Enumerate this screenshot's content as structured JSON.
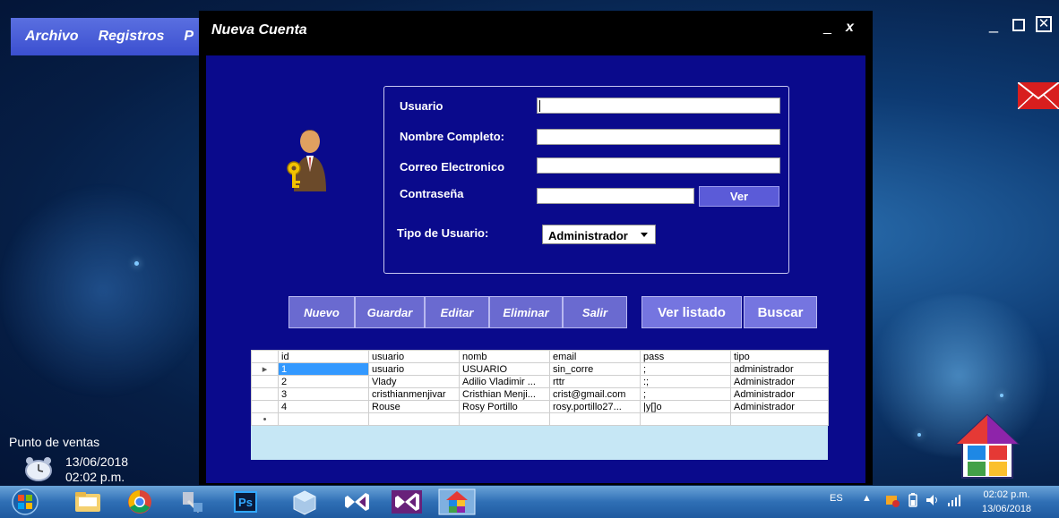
{
  "main_window": {
    "menu": [
      "Archivo",
      "Registros",
      "P"
    ],
    "controls": {
      "minimize": "_",
      "restore": "□",
      "close": "✕"
    }
  },
  "desktop": {
    "pos_label": "Punto de ventas",
    "date": "13/06/2018",
    "time": "02:02 p.m."
  },
  "dialog": {
    "title": "Nueva Cuenta",
    "minimize": "_",
    "close": "x",
    "form": {
      "usuario_label": "Usuario",
      "usuario_value": "",
      "nombre_label": "Nombre Completo:",
      "nombre_value": "",
      "correo_label": "Correo Electronico",
      "correo_value": "",
      "pass_label": "Contraseña",
      "pass_value": "",
      "ver_label": "Ver",
      "tipo_label": "Tipo de Usuario:",
      "tipo_value": "Administrador"
    },
    "buttons": {
      "nuevo": "Nuevo",
      "guardar": "Guardar",
      "editar": "Editar",
      "eliminar": "Eliminar",
      "salir": "Salir",
      "ver_listado": "Ver listado",
      "buscar": "Buscar"
    },
    "grid": {
      "columns": [
        "id",
        "usuario",
        "nomb",
        "email",
        "pass",
        "tipo"
      ],
      "rows": [
        [
          "1",
          "usuario",
          "USUARIO",
          "sin_corre",
          ";",
          "administrador"
        ],
        [
          "2",
          "Vlady",
          "Adilio Vladimir ...",
          "rttr",
          ":;",
          "Administrador"
        ],
        [
          "3",
          "cristhianmenjivar",
          "Cristhian Menji...",
          "crist@gmail.com",
          ";",
          "Administrador"
        ],
        [
          "4",
          "Rouse",
          "Rosy Portillo",
          "rosy.portillo27...",
          "|y[]o",
          "Administrador"
        ]
      ],
      "new_row_marker": "•",
      "current_row_marker": "▸"
    }
  },
  "taskbar": {
    "apps": [
      "start-orb",
      "file-explorer",
      "chrome",
      "tool-app",
      "photoshop",
      "virtualbox",
      "visual-studio",
      "visual-studio-2",
      "punto-de-ventas"
    ],
    "photoshop_label": "Ps",
    "language": "ES",
    "tray_up": "▲",
    "clock_time": "02:02 p.m.",
    "clock_date": "13/06/2018"
  }
}
